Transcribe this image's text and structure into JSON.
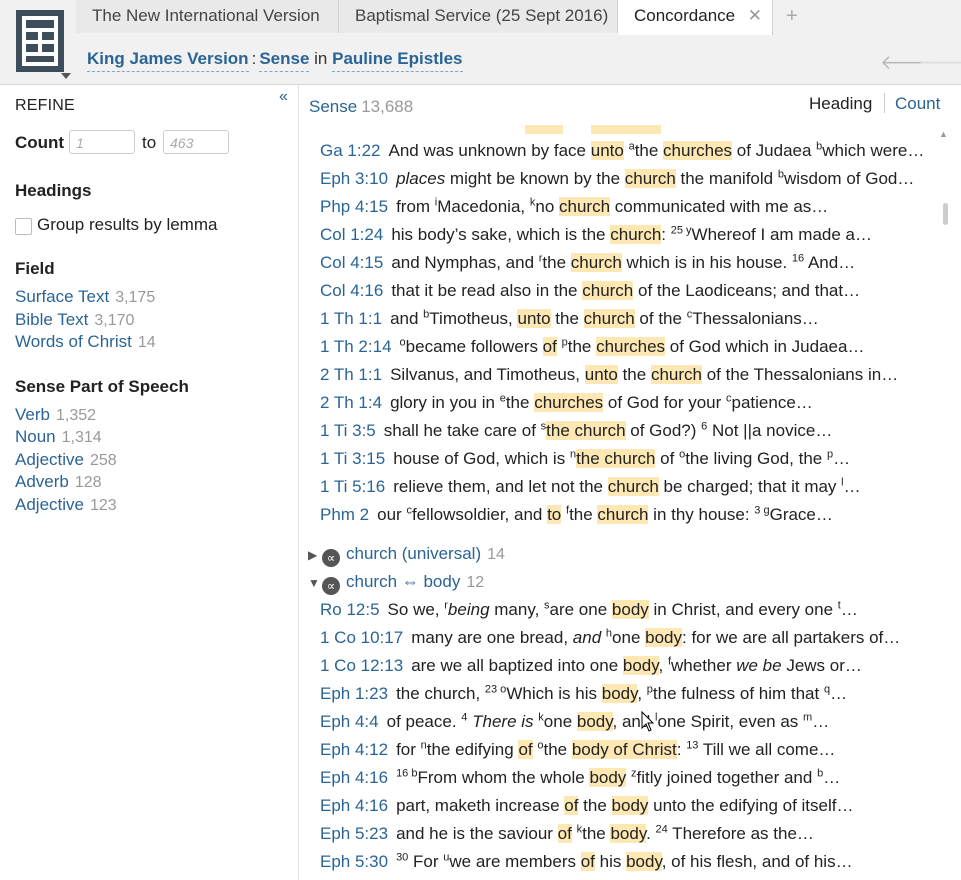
{
  "tabs": [
    {
      "label": "The New International Version"
    },
    {
      "label": "Baptismal Service (25 Sept 2016)"
    },
    {
      "label": "Concordance",
      "close": "✕"
    }
  ],
  "tab_add": "+",
  "breadcrumb": {
    "version": "King James Version",
    "sep": ":",
    "field": "Sense",
    "in": "in",
    "scope": "Pauline Epistles"
  },
  "nav": {
    "back": "🡐",
    "forward": "🡒"
  },
  "refine": {
    "collapse": "«",
    "title": "REFINE",
    "count_label": "Count",
    "count_min_placeholder": "1",
    "count_to": "to",
    "count_max_placeholder": "463",
    "headings_title": "Headings",
    "group_by_lemma": "Group results by lemma",
    "field_title": "Field",
    "fields": [
      {
        "label": "Surface Text",
        "count": "3,175"
      },
      {
        "label": "Bible Text",
        "count": "3,170"
      },
      {
        "label": "Words of Christ",
        "count": "14"
      }
    ],
    "pos_title": "Sense Part of Speech",
    "pos": [
      {
        "label": "Verb",
        "count": "1,352"
      },
      {
        "label": "Noun",
        "count": "1,314"
      },
      {
        "label": "Adjective",
        "count": "258"
      },
      {
        "label": "Adverb",
        "count": "128"
      },
      {
        "label": "Adjective",
        "count": "123"
      }
    ]
  },
  "main": {
    "title": "Sense",
    "title_count": "13,688",
    "view_heading": "Heading",
    "view_count": "Count",
    "groups": [
      {
        "label": "church (universal)",
        "count": "14",
        "expanded": false
      },
      {
        "label": "church ⇔ body",
        "count": "12",
        "expanded": true
      }
    ]
  },
  "colors": {
    "link": "#2a6496",
    "highlight": "#fde7b3",
    "muted": "#999999"
  },
  "rows_a": [
    {
      "ref": "Ga 1:22",
      "html": "And was unknown by face <span class=\"hl\">unto</span> <sup>a</sup>the <span class=\"hl\">churches</span> of Judaea <sup>b</sup>which were…"
    },
    {
      "ref": "Eph 3:10",
      "html": "<i>places</i> might be known by the <span class=\"hl\">church</span> the manifold <sup>b</sup>wisdom of God…"
    },
    {
      "ref": "Php 4:15",
      "html": "from <sup>i</sup>Macedonia, <sup>k</sup>no <span class=\"hl\">church</span> communicated with me as…"
    },
    {
      "ref": "Col 1:24",
      "html": "his body’s sake, which is the <span class=\"hl\">church</span>: <sup>25 y</sup>Whereof I am made a…"
    },
    {
      "ref": "Col 4:15",
      "html": "and Nymphas, and <sup>r</sup>the <span class=\"hl\">church</span> which is in his house. <sup>16</sup> And…"
    },
    {
      "ref": "Col 4:16",
      "html": "that it be read also in the <span class=\"hl\">church</span> of the Laodiceans; and that…"
    },
    {
      "ref": "1 Th 1:1",
      "html": "and <sup>b</sup>Timotheus, <span class=\"hl\">unto</span> the <span class=\"hl\">church</span> of the <sup>c</sup>Thessalonians…"
    },
    {
      "ref": "1 Th 2:14",
      "html": "<sup>o</sup>became followers <span class=\"hl\">of</span> <sup>p</sup>the <span class=\"hl\">churches</span> of God which in Judaea…"
    },
    {
      "ref": "2 Th 1:1",
      "html": "Silvanus, and Timotheus, <span class=\"hl\">unto</span> the <span class=\"hl\">church</span> of the Thessalonians in…"
    },
    {
      "ref": "2 Th 1:4",
      "html": "glory in you in <sup>e</sup>the <span class=\"hl\">churches</span> of God for your <sup>c</sup>patience…"
    },
    {
      "ref": "1 Ti 3:5",
      "html": "shall he take care of <sup>s</sup><span class=\"hl\">the church</span> of God?) <sup>6</sup> Not ||a novice…"
    },
    {
      "ref": "1 Ti 3:15",
      "html": "house of God, which is <sup>n</sup><span class=\"hl\">the church</span> of <sup>o</sup>the living God, the <sup>p</sup>…"
    },
    {
      "ref": "1 Ti 5:16",
      "html": "relieve them, and let not the <span class=\"hl\">church</span> be charged; that it may <sup>l</sup>…"
    },
    {
      "ref": "Phm 2",
      "html": "our <sup>c</sup>fellowsoldier, and <span class=\"hl\">to</span> <sup>f</sup>the <span class=\"hl\">church</span> in thy house: <sup>3 g</sup>Grace…"
    }
  ],
  "rows_b": [
    {
      "ref": "Ro 12:5",
      "html": "So we, <sup>r</sup><i>being</i> many, <sup>s</sup>are one <span class=\"hl\">body</span> in Christ, and every one <sup>t</sup>…"
    },
    {
      "ref": "1 Co 10:17",
      "html": "many are one bread, <i>and</i> <sup>h</sup>one <span class=\"hl\">body</span>: for we are all partakers of…"
    },
    {
      "ref": "1 Co 12:13",
      "html": "are we all baptized into one <span class=\"hl\">body</span>, <sup>f</sup>whether <i>we be</i> Jews or…"
    },
    {
      "ref": "Eph 1:23",
      "html": "the church, <sup>23 o</sup>Which is his <span class=\"hl\">body</span>, <sup>p</sup>the fulness of him that <sup>q</sup>…"
    },
    {
      "ref": "Eph 4:4",
      "html": "of peace. <sup>4</sup> <i>There is</i> <sup>k</sup>one <span class=\"hl\">body</span>, and <sup>l</sup>one Spirit, even as <sup>m</sup>…"
    },
    {
      "ref": "Eph 4:12",
      "html": "for <sup>n</sup>the edifying <span class=\"hl\">of</span> <sup>o</sup>the <span class=\"hl\">body of Christ</span>: <sup>13</sup> Till we all come…"
    },
    {
      "ref": "Eph 4:16",
      "html": "<sup>16 b</sup>From whom the whole <span class=\"hl\">body</span> <sup>z</sup>fitly joined together and <sup>b</sup>…"
    },
    {
      "ref": "Eph 4:16",
      "html": "part, maketh increase <span class=\"hl\">of</span> the <span class=\"hl\">body</span> unto the edifying of itself…"
    },
    {
      "ref": "Eph 5:23",
      "html": "and he is the saviour <span class=\"hl\">of</span> <sup>k</sup>the <span class=\"hl\">body</span>. <sup>24</sup> Therefore as the…"
    },
    {
      "ref": "Eph 5:30",
      "html": "<sup>30</sup> For <sup>u</sup>we are members <span class=\"hl\">of</span> his <span class=\"hl\">body</span>, of his flesh, and of his…"
    }
  ]
}
